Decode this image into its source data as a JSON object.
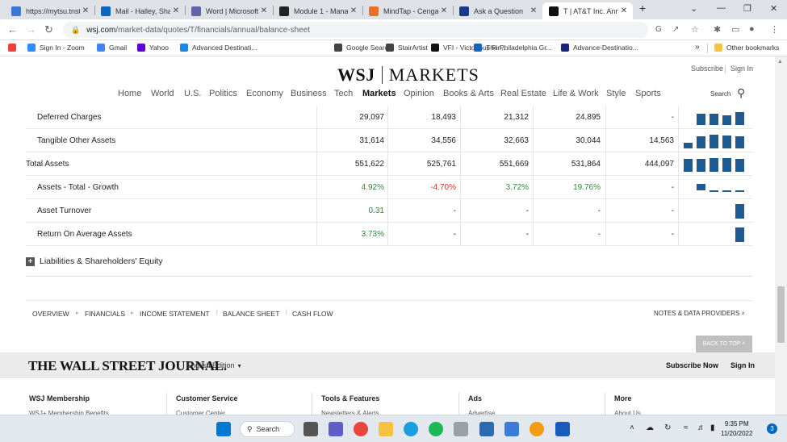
{
  "browser": {
    "tabs": [
      {
        "title": "https://mytsu.tnst",
        "color": "#3c78d8",
        "icon": "globe-icon"
      },
      {
        "title": "Mail - Halley, Sha",
        "color": "#0a66c2",
        "icon": "outlook-icon"
      },
      {
        "title": "Word | Microsoft",
        "color": "#6264a7",
        "icon": "teams-icon"
      },
      {
        "title": "Module 1 - Mana",
        "color": "#222222",
        "icon": "d2l-icon"
      },
      {
        "title": "MindTap - Cenga",
        "color": "#e8702a",
        "icon": "mindtap-icon"
      },
      {
        "title": "Ask a Question",
        "color": "#1a3a8a",
        "icon": "chegg-icon"
      },
      {
        "title": "T | AT&T Inc. Ann",
        "color": "#111111",
        "icon": "wsj-icon"
      }
    ],
    "url_host": "wsj.com",
    "url_path": "/market-data/quotes/T/financials/annual/balance-sheet",
    "bookmarks": [
      {
        "label": "",
        "color": "#ea4335",
        "icon": "gmail-icon"
      },
      {
        "label": "Sign In - Zoom",
        "color": "#2d8cff",
        "icon": "zoom-icon"
      },
      {
        "label": "Gmail",
        "color": "#4285f4",
        "icon": "google-icon"
      },
      {
        "label": "Yahoo",
        "color": "#6001d2",
        "icon": "yahoo-icon"
      },
      {
        "label": "Advanced Destinati...",
        "color": "#1e88e5",
        "icon": "site-icon"
      },
      {
        "label": "Google Search",
        "color": "#444444",
        "icon": "github-icon"
      },
      {
        "label": "StairArtist",
        "color": "#444444",
        "icon": "site-icon"
      },
      {
        "label": "VFI - Victorious Fin...",
        "color": "#111111",
        "icon": "wix-icon"
      },
      {
        "label": "The Philadelphia Gr...",
        "color": "#1565c0",
        "icon": "site-icon"
      },
      {
        "label": "Advance-Destinatio...",
        "color": "#1a237e",
        "icon": "site-icon"
      }
    ],
    "other_bookmarks": "Other bookmarks",
    "more_bookmarks": "»"
  },
  "wsj": {
    "logo_left": "WSJ",
    "logo_right": "MARKETS",
    "subscribe": "Subscribe",
    "sign_in": "Sign In",
    "nav": [
      "Home",
      "World",
      "U.S.",
      "Politics",
      "Economy",
      "Business",
      "Tech",
      "Markets",
      "Opinion",
      "Books & Arts",
      "Real Estate",
      "Life & Work",
      "Style",
      "Sports"
    ],
    "active_nav": "Markets",
    "search": "Search"
  },
  "table": {
    "rows": [
      {
        "label": "Deferred Charges",
        "indent": true,
        "values": [
          "29,097",
          "18,493",
          "21,312",
          "24,895",
          "-"
        ],
        "kind": "plain",
        "spark": [
          0.75,
          0.75,
          0.65,
          0.9
        ]
      },
      {
        "label": "Tangible Other Assets",
        "indent": true,
        "values": [
          "31,614",
          "34,556",
          "32,663",
          "30,044",
          "14,563"
        ],
        "kind": "plain",
        "spark": [
          0.4,
          0.85,
          0.95,
          0.9,
          0.85
        ]
      },
      {
        "label": "Total Assets",
        "indent": false,
        "values": [
          "551,622",
          "525,761",
          "551,669",
          "531,864",
          "444,097"
        ],
        "kind": "plain",
        "spark": [
          0.9,
          0.9,
          0.95,
          0.92,
          0.9
        ]
      },
      {
        "label": "Assets - Total - Growth",
        "indent": true,
        "values": [
          "4.92%",
          "-4.70%",
          "3.72%",
          "19.76%",
          "-"
        ],
        "kind": "growth",
        "spark": [
          0.45,
          0.15,
          0.05,
          0.15
        ]
      },
      {
        "label": "Asset Turnover",
        "indent": true,
        "values": [
          "0.31",
          "-",
          "-",
          "-",
          "-"
        ],
        "kind": "growth",
        "spark": [
          0,
          0,
          0,
          0,
          1
        ]
      },
      {
        "label": "Return On Average Assets",
        "indent": true,
        "values": [
          "3.73%",
          "-",
          "-",
          "-",
          "-"
        ],
        "kind": "growth",
        "spark": [
          0,
          0,
          0,
          0,
          1
        ]
      }
    ],
    "liabilities_label": "Liabilities & Shareholders' Equity"
  },
  "subnav": {
    "items": [
      "OVERVIEW",
      "FINANCIALS",
      "INCOME STATEMENT",
      "BALANCE SHEET",
      "CASH FLOW"
    ],
    "notes": "NOTES & DATA PROVIDERS",
    "back_to_top": "BACK TO TOP"
  },
  "footer": {
    "logo": "THE WALL STREET JOURNAL.",
    "edition": "English Edition",
    "subscribe_now": "Subscribe Now",
    "sign_in": "Sign In",
    "columns": [
      {
        "title": "WSJ Membership",
        "sub": "WSJ+ Membership Benefits"
      },
      {
        "title": "Customer Service",
        "sub": "Customer Center"
      },
      {
        "title": "Tools & Features",
        "sub": "Newsletters & Alerts"
      },
      {
        "title": "Ads",
        "sub": "Advertise"
      },
      {
        "title": "More",
        "sub": "About Us"
      }
    ]
  },
  "taskbar": {
    "search": "Search",
    "time": "9:35 PM",
    "date": "11/20/2022",
    "notifications": "3"
  },
  "colors": {
    "bar": "#1f5a93",
    "positive": "#2e8b3b",
    "negative": "#d93025"
  }
}
